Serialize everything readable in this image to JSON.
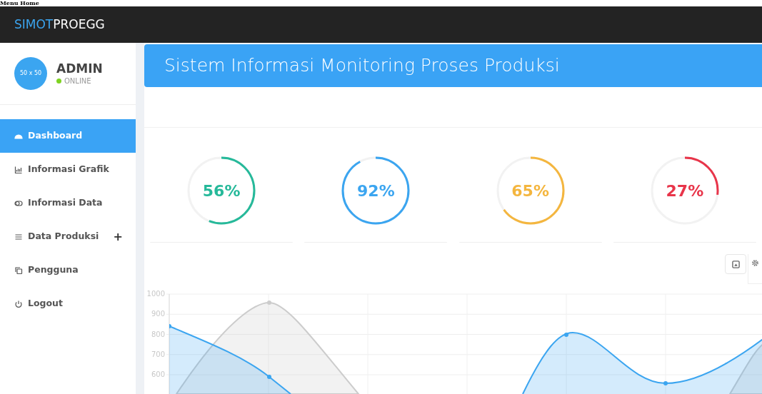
{
  "page_heading": "Menu Home",
  "brand": {
    "part_1": "SIMOT",
    "part_2": "PROEGG"
  },
  "user": {
    "avatar_text": "50 x 50",
    "name": "ADMIN",
    "status": "ONLINE",
    "online": true
  },
  "sidebar": {
    "items": [
      {
        "label": "Dashboard",
        "kind": "dashboard",
        "selected": true
      },
      {
        "label": "Informasi Grafik",
        "kind": "chart",
        "selected": false
      },
      {
        "label": "Informasi Data",
        "kind": "toggle",
        "selected": false
      },
      {
        "label": "Data Produksi",
        "kind": "bars",
        "selected": false,
        "expand_sign": "+"
      },
      {
        "label": "Pengguna",
        "kind": "copy",
        "selected": false
      },
      {
        "label": "Logout",
        "kind": "power",
        "selected": false
      }
    ]
  },
  "banner": {
    "title": "Sistem Informasi Monitoring Proses Produksi"
  },
  "gauges": [
    {
      "reading": "56%",
      "color": "#26b99a"
    },
    {
      "reading": "92%",
      "color": "#3ba5f0"
    },
    {
      "reading": "65%",
      "color": "#f4b63f"
    },
    {
      "reading": "27%",
      "color": "#e8354a"
    }
  ],
  "chart": {
    "y_axis_labels": [
      "1000",
      "900",
      "800",
      "700",
      "600"
    ]
  }
}
